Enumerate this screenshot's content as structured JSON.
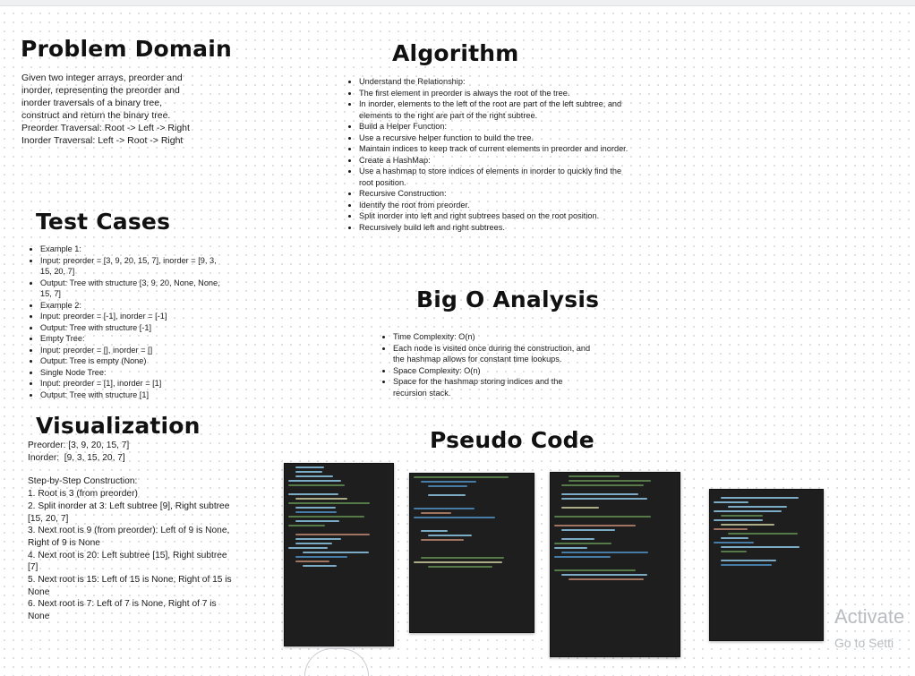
{
  "sections": {
    "problem_domain": {
      "title": "Problem Domain",
      "lines": [
        "Given two integer arrays, preorder and",
        "inorder, representing the preorder and",
        "inorder traversals of a binary tree,",
        "construct and return the binary tree.",
        "Preorder Traversal: Root -> Left -> Right",
        "Inorder Traversal: Left -> Root -> Right"
      ]
    },
    "algorithm": {
      "title": "Algorithm",
      "items": [
        "Understand the Relationship:",
        "The first element in preorder is always the root of the tree.",
        "In inorder, elements to the left of the root are part of the left subtree, and elements to the right are part of the right subtree.",
        "Build a Helper Function:",
        "Use a recursive helper function to build the tree.",
        "Maintain indices to keep track of current elements in preorder and inorder.",
        "Create a HashMap:",
        "Use a hashmap to store indices of elements in inorder to quickly find the root position.",
        "Recursive Construction:",
        "Identify the root from preorder.",
        "Split inorder into left and right subtrees based on the root position.",
        "Recursively build left and right subtrees."
      ]
    },
    "test_cases": {
      "title": "Test Cases",
      "items": [
        "Example 1:",
        "Input: preorder = [3, 9, 20, 15, 7], inorder = [9, 3, 15, 20, 7]",
        "Output: Tree with structure [3, 9, 20, None, None, 15, 7]",
        "Example 2:",
        "Input: preorder = [-1], inorder = [-1]",
        "Output: Tree with structure [-1]",
        "Empty Tree:",
        "Input: preorder = [], inorder = []",
        "Output: Tree is empty (None)",
        "Single Node Tree:",
        "Input: preorder = [1], inorder = [1]",
        "Output: Tree with structure [1]"
      ]
    },
    "big_o": {
      "title": "Big O Analysis",
      "items": [
        "Time Complexity: O(n)",
        "Each node is visited once during the construction, and the hashmap allows for constant time lookups.",
        "Space Complexity: O(n)",
        "Space for the hashmap storing indices and the recursion stack."
      ]
    },
    "visualization": {
      "title": "Visualization",
      "preorder": "Preorder: [3, 9, 20, 15, 7]",
      "inorder": "Inorder:  [9, 3, 15, 20, 7]",
      "steps_title": "Step-by-Step Construction:",
      "steps": [
        "1. Root is 3 (from preorder)",
        "2. Split inorder at 3: Left subtree [9], Right subtree [15, 20, 7]",
        "3. Next root is 9 (from preorder): Left of 9 is None, Right of 9 is None",
        "4. Next root is 20: Left subtree [15], Right subtree [7]",
        "5. Next root is 15: Left of 15 is None, Right of 15 is None",
        "6. Next root is 7: Left of 7 is None, Right of 7 is None"
      ]
    },
    "pseudo_code": {
      "title": "Pseudo Code"
    }
  },
  "watermark": {
    "title": "Activate",
    "subtitle": "Go to Setti"
  },
  "colors": {
    "code_bg": "#1e1e1e",
    "code_blue": "#569cd6",
    "code_green": "#6a9955",
    "code_orange": "#ce9178",
    "code_yellow": "#dcdcaa",
    "code_text": "#9cdcfe"
  }
}
